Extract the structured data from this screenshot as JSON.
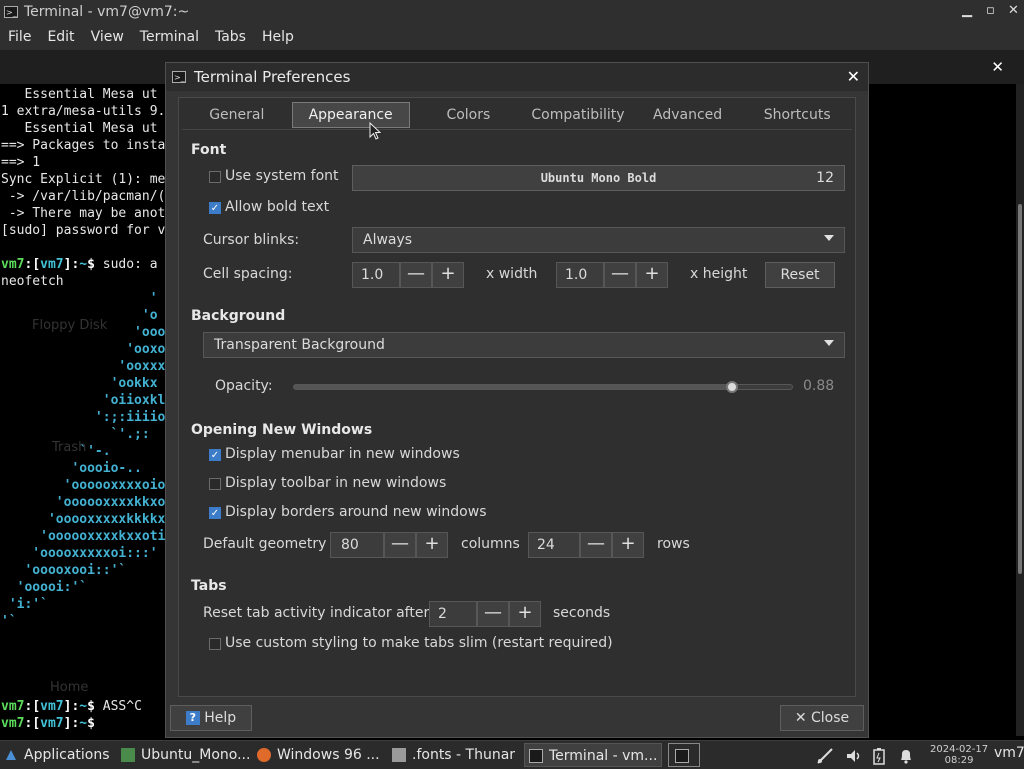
{
  "terminal": {
    "title": "Terminal - vm7@vm7:~",
    "menu": [
      "File",
      "Edit",
      "View",
      "Terminal",
      "Tabs",
      "Help"
    ],
    "lines": [
      "   Essential Mesa ut",
      "1 extra/mesa-utils 9.",
      "   Essential Mesa ut",
      "==> Packages to insta",
      "==> 1",
      "Sync Explicit (1): me",
      " -> /var/lib/pacman/(",
      " -> There may be anot",
      "[sudo] password for v"
    ],
    "prompt_user": "vm7",
    "prompt_sep": ":",
    "prompt_dir": "~",
    "cmd1": " sudo: a",
    "line_neofetch": "neofetch",
    "art": [
      "                   '",
      "                  'o",
      "                 'ooo",
      "                'ooxo",
      "               'ooxxx",
      "              'ookkx",
      "             'oiioxkl",
      "            ':;:iiiio",
      "              `'.;:",
      "          `'-.",
      "         'oooio-..",
      "        'oooooxxxxoio",
      "       'oooooxxxxkkxo",
      "      'ooooxxxxxkkkkx",
      "     'oooooxxxxkxxoti",
      "    'ooooxxxxxoi:::'",
      "   'ooooxooi::'`",
      "  'ooooi:'`",
      " 'i:'`",
      "'`"
    ],
    "cmd2": " ASS^C",
    "cmd3": ""
  },
  "desktop_icons": [
    "Floppy Disk",
    "Trash",
    "Home"
  ],
  "dialog": {
    "title": "Terminal Preferences",
    "tabs": [
      "General",
      "Appearance",
      "Colors",
      "Compatibility",
      "Advanced",
      "Shortcuts"
    ],
    "active_tab": "Appearance",
    "font": {
      "section": "Font",
      "use_system_font": "Use system font",
      "font_name": "Ubuntu Mono Bold",
      "font_size": "12",
      "allow_bold": "Allow bold text",
      "cursor_blinks_label": "Cursor blinks:",
      "cursor_blinks_value": "Always",
      "cell_spacing_label": "Cell spacing:",
      "width_value": "1.0",
      "width_label": "x width",
      "height_value": "1.0",
      "height_label": "x height",
      "reset": "Reset",
      "minus": "—",
      "plus": "+"
    },
    "background": {
      "section": "Background",
      "mode": "Transparent Background",
      "opacity_label": "Opacity:",
      "opacity_value": "0.88",
      "opacity_fraction": 0.88
    },
    "windows": {
      "section": "Opening New Windows",
      "menubar": "Display menubar in new windows",
      "toolbar": "Display toolbar in new windows",
      "borders": "Display borders around new windows",
      "geometry_label": "Default geometry",
      "columns_value": "80",
      "columns_label": "columns",
      "rows_value": "24",
      "rows_label": "rows"
    },
    "tabs_section": {
      "section": "Tabs",
      "reset_label": "Reset tab activity indicator after",
      "reset_value": "2",
      "seconds": "seconds",
      "slim": "Use custom styling to make tabs slim (restart required)"
    },
    "help_button": "Help",
    "close_button": "Close",
    "close_x": "✕"
  },
  "taskbar": {
    "applications": "Applications",
    "tasks": [
      "Ubuntu_Mono...",
      "Windows 96 ...",
      ".fonts - Thunar",
      "Terminal - vm..."
    ],
    "clock_date": "2024-02-17",
    "clock_time": "08:29",
    "user": "vm7"
  },
  "colors": {
    "accent": "#3d7cc9",
    "prompt_green": "#5bdc5b",
    "prompt_cyan": "#42c2d6"
  }
}
